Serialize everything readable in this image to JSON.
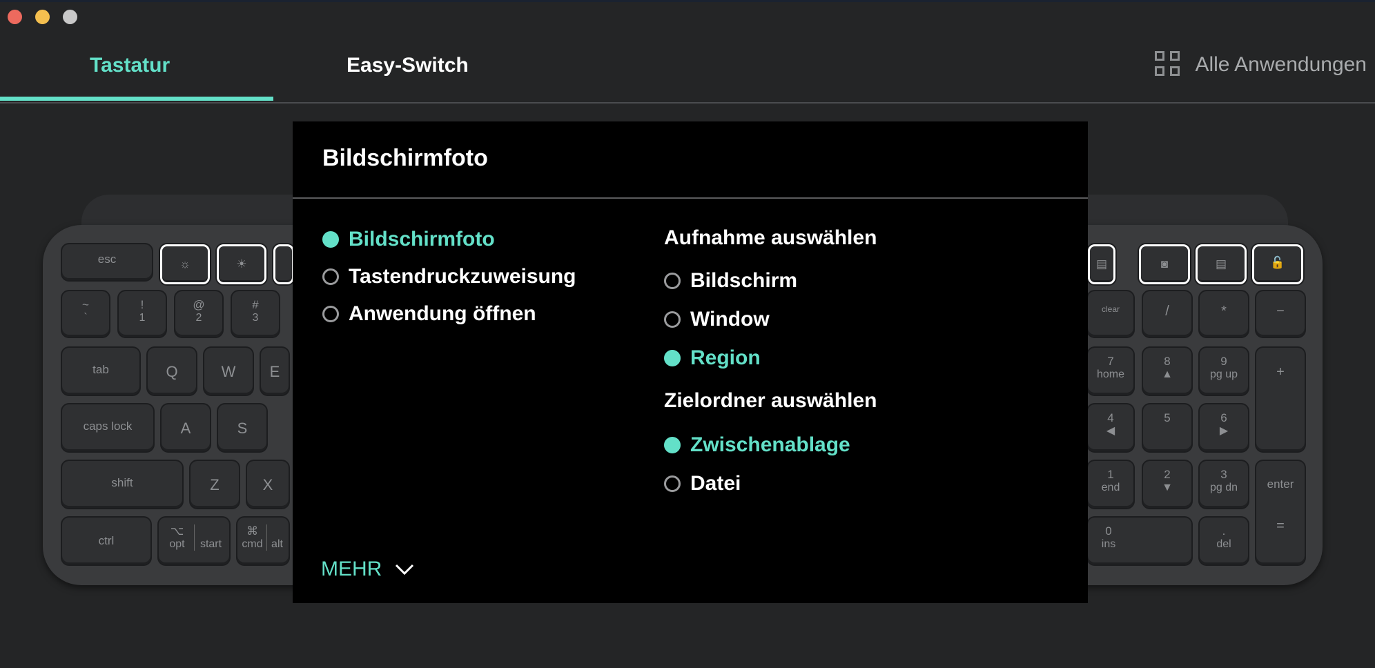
{
  "window": {
    "controls": [
      "close",
      "minimize",
      "zoom"
    ]
  },
  "tabs": [
    {
      "label": "Tastatur",
      "active": true
    },
    {
      "label": "Easy-Switch",
      "active": false
    }
  ],
  "all_apps": {
    "label": "Alle Anwendungen",
    "icon": "grid-icon"
  },
  "accent_color": "#63e0c8",
  "keyboard": {
    "row_fn": {
      "esc": "esc"
    },
    "row_num": [
      {
        "top": "~",
        "bottom": "`"
      },
      {
        "top": "!",
        "bottom": "1"
      },
      {
        "top": "@",
        "bottom": "2"
      },
      {
        "top": "#",
        "bottom": "3"
      }
    ],
    "row_q": [
      "tab",
      "Q",
      "W",
      "E"
    ],
    "row_a": [
      "caps lock",
      "A",
      "S"
    ],
    "row_z": [
      "shift",
      "Z",
      "X"
    ],
    "row_bottom": [
      {
        "top": "",
        "bottom": "ctrl"
      },
      {
        "top": "⌥",
        "bottom": "opt"
      },
      {
        "top": "",
        "bottom": "start"
      },
      {
        "top": "⌘",
        "bottom": "cmd"
      },
      {
        "top": "",
        "bottom": "alt"
      }
    ],
    "numpad": {
      "top_row": [
        "clear",
        "/",
        "*",
        "−"
      ],
      "rows": [
        [
          {
            "top": "7",
            "bottom": "home"
          },
          {
            "top": "8",
            "bottom": "▲"
          },
          {
            "top": "9",
            "bottom": "pg up"
          }
        ],
        [
          {
            "top": "4",
            "bottom": "◀"
          },
          {
            "top": "5",
            "bottom": ""
          },
          {
            "top": "6",
            "bottom": "▶"
          }
        ],
        [
          {
            "top": "1",
            "bottom": "end"
          },
          {
            "top": "2",
            "bottom": "▼"
          },
          {
            "top": "3",
            "bottom": "pg dn"
          }
        ],
        [
          {
            "top": "0",
            "bottom": "ins"
          },
          {
            "top": ".",
            "bottom": "del"
          }
        ]
      ],
      "plus": "+",
      "enter": "enter",
      "equals": "="
    }
  },
  "dialog": {
    "title": "Bildschirmfoto",
    "actions": [
      {
        "label": "Bildschirmfoto",
        "selected": true
      },
      {
        "label": "Tastendruckzuweisung",
        "selected": false
      },
      {
        "label": "Anwendung öffnen",
        "selected": false
      }
    ],
    "capture_heading": "Aufnahme auswählen",
    "capture_options": [
      {
        "label": "Bildschirm",
        "selected": false
      },
      {
        "label": "Window",
        "selected": false
      },
      {
        "label": "Region",
        "selected": true
      }
    ],
    "target_heading": "Zielordner auswählen",
    "target_options": [
      {
        "label": "Zwischenablage",
        "selected": true
      },
      {
        "label": "Datei",
        "selected": false
      }
    ],
    "more_label": "MEHR"
  }
}
